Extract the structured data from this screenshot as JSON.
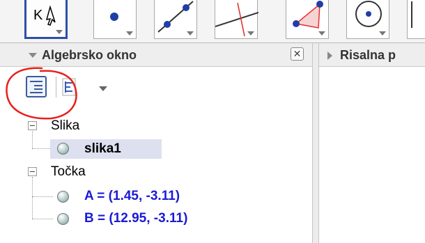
{
  "toolbar": {
    "tools": [
      {
        "icon": "move-cursor-icon",
        "selected": true
      },
      {
        "icon": "point-icon",
        "selected": false
      },
      {
        "icon": "line-through-points-icon",
        "selected": false
      },
      {
        "icon": "perpendicular-line-icon",
        "selected": false
      },
      {
        "icon": "polygon-icon",
        "selected": false
      },
      {
        "icon": "circle-center-point-icon",
        "selected": false
      },
      {
        "icon": "more-tools-icon",
        "selected": false
      }
    ]
  },
  "algebra_panel": {
    "title": "Algebrsko okno",
    "close_glyph": "✕",
    "tree": [
      {
        "label": "Slika",
        "items": [
          {
            "text": "slika1",
            "color": "#000000",
            "selected": true
          }
        ]
      },
      {
        "label": "Točka",
        "items": [
          {
            "text": "A = (1.45, -3.11)",
            "color": "#1a1ad6",
            "selected": false
          },
          {
            "text": "B = (12.95, -3.11)",
            "color": "#1a1ad6",
            "selected": false
          }
        ]
      }
    ]
  },
  "graphics_panel": {
    "title": "Risalna p"
  },
  "annotation": {
    "color": "#e8201d",
    "shape": "hand-drawn-circle"
  }
}
